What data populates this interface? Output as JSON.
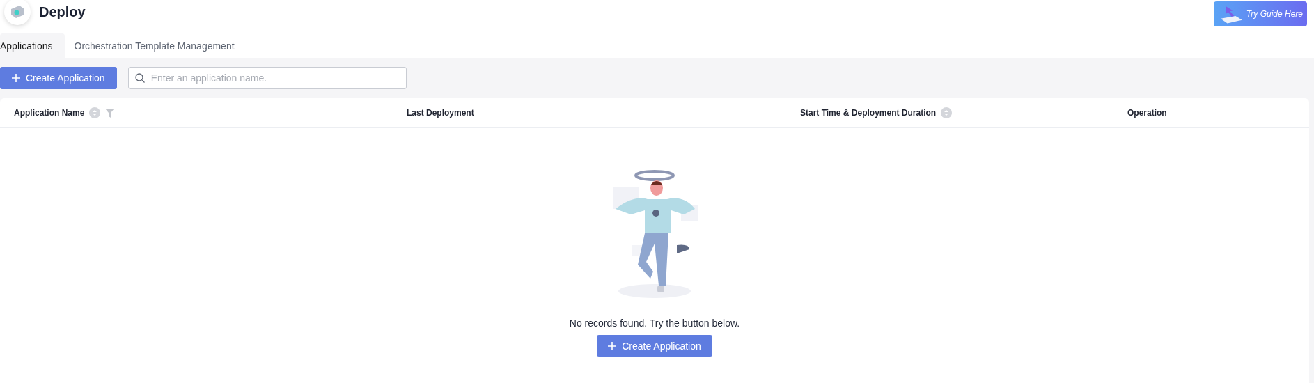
{
  "header": {
    "title": "Deploy",
    "guide_button": "Try Guide Here"
  },
  "tabs": [
    {
      "label": "Applications",
      "selected": true
    },
    {
      "label": "Orchestration Template Management",
      "selected": false
    }
  ],
  "toolbar": {
    "create_button": "Create Application",
    "search": {
      "placeholder": "Enter an application name."
    }
  },
  "table": {
    "columns": [
      {
        "label": "Application Name",
        "icons": [
          {
            "kind": "sort"
          },
          {
            "kind": "filter"
          }
        ]
      },
      {
        "label": "Last Deployment"
      },
      {
        "label": "Start Time & Deployment Duration",
        "icons": [
          {
            "kind": "sort"
          }
        ]
      },
      {
        "label": "Operation"
      }
    ],
    "empty_state": {
      "message": "No records found. Try the button below.",
      "button": "Create Application"
    }
  }
}
